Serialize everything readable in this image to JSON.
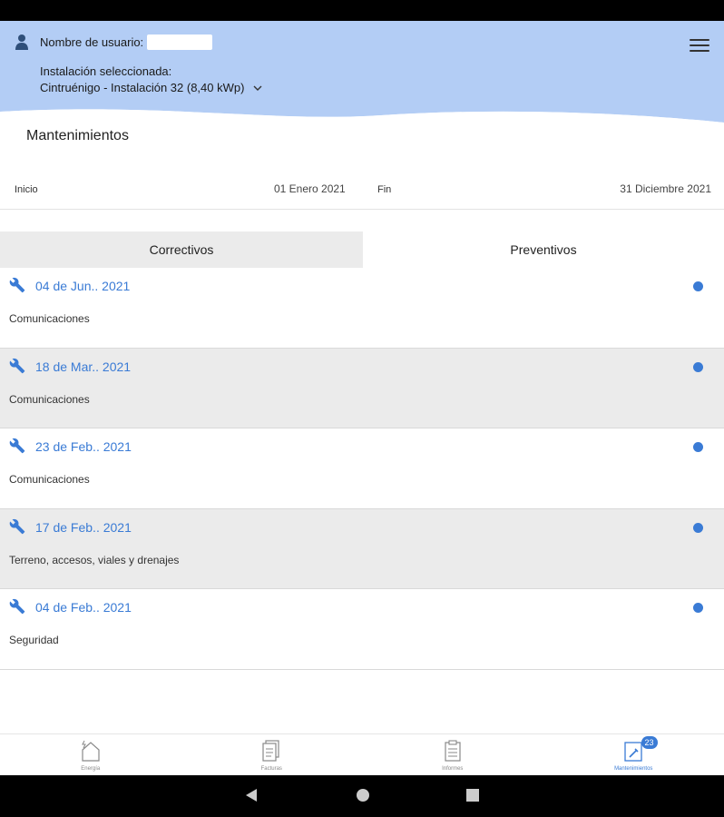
{
  "header": {
    "user_label": "Nombre de usuario:",
    "installation_label": "Instalación seleccionada:",
    "installation_value": "Cintruénigo - Instalación 32 (8,40 kWp)"
  },
  "page": {
    "title": "Mantenimientos"
  },
  "date_range": {
    "start_label": "Inicio",
    "start_value": "01 Enero 2021",
    "end_label": "Fin",
    "end_value": "31 Diciembre 2021"
  },
  "tabs": [
    {
      "label": "Correctivos",
      "active": false
    },
    {
      "label": "Preventivos",
      "active": true
    }
  ],
  "maintenances": [
    {
      "date": "04 de Jun.. 2021",
      "description": "Comunicaciones"
    },
    {
      "date": "18 de Mar.. 2021",
      "description": "Comunicaciones"
    },
    {
      "date": "23 de Feb.. 2021",
      "description": "Comunicaciones"
    },
    {
      "date": "17 de Feb.. 2021",
      "description": "Terreno, accesos, viales y drenajes"
    },
    {
      "date": "04 de Feb.. 2021",
      "description": "Seguridad"
    }
  ],
  "bottom_nav": [
    {
      "label": "Energía",
      "icon": "house-icon"
    },
    {
      "label": "Facturas",
      "icon": "invoice-icon"
    },
    {
      "label": "Informes",
      "icon": "clipboard-icon"
    },
    {
      "label": "Mantenimientos",
      "icon": "maintenance-icon",
      "badge": "23"
    }
  ],
  "colors": {
    "accent": "#3a7bd5",
    "header_bg": "#b3cdf5",
    "alt_row": "#ebebeb"
  }
}
